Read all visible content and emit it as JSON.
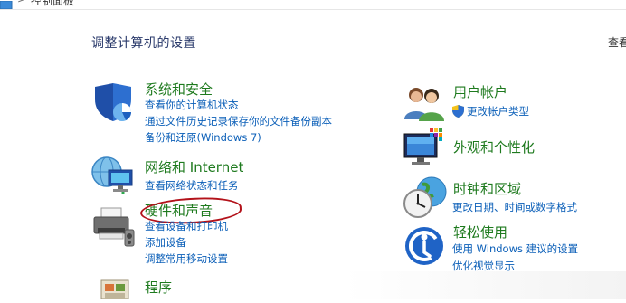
{
  "breadcrumb": {
    "separator": ">",
    "current": "控制面板"
  },
  "page": {
    "title": "调整计算机的设置",
    "view_by_label": "查看"
  },
  "colors": {
    "title_green": "#1e7a1e",
    "link_blue": "#0b5fb8",
    "heading_navy": "#2a3a6b",
    "annotation_red": "#b3121a"
  },
  "categories": {
    "system_security": {
      "icon": "shield-icon",
      "title": "系统和安全",
      "links": [
        "查看你的计算机状态",
        "通过文件历史记录保存你的文件备份副本",
        "备份和还原(Windows 7)"
      ]
    },
    "network": {
      "icon": "network-globe-icon",
      "title": "网络和 Internet",
      "links": [
        "查看网络状态和任务"
      ]
    },
    "hardware": {
      "icon": "printer-icon",
      "title": "硬件和声音",
      "links": [
        "查看设备和打印机",
        "添加设备",
        "调整常用移动设置"
      ]
    },
    "programs": {
      "icon": "programs-icon",
      "title": "程序"
    },
    "user_accounts": {
      "icon": "users-icon",
      "title": "用户帐户",
      "links": [
        "更改帐户类型"
      ]
    },
    "appearance": {
      "icon": "monitor-icon",
      "title": "外观和个性化"
    },
    "clock_region": {
      "icon": "clock-globe-icon",
      "title": "时钟和区域",
      "links": [
        "更改日期、时间或数字格式"
      ]
    },
    "ease_access": {
      "icon": "ease-of-access-icon",
      "title": "轻松使用",
      "links": [
        "使用 Windows 建议的设置",
        "优化视觉显示"
      ]
    }
  }
}
